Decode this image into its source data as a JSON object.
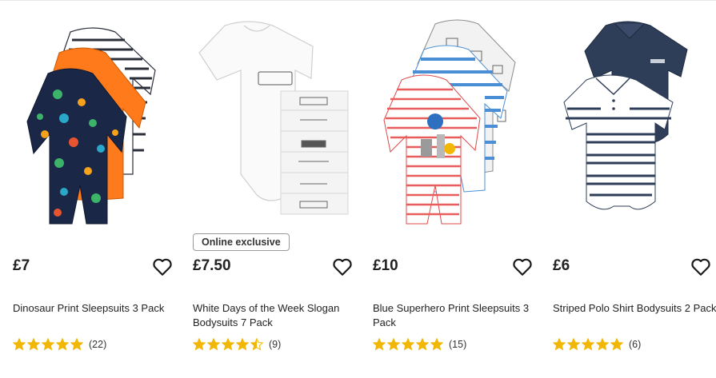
{
  "products": [
    {
      "title": "Dinosaur Print Sleepsuits 3 Pack",
      "price": "£7",
      "badge": "",
      "rating": 5,
      "review_count": "(22)",
      "image_icon": "dinosaur-sleepsuits-image"
    },
    {
      "title": "White Days of the Week Slogan Bodysuits 7 Pack",
      "price": "£7.50",
      "badge": "Online exclusive",
      "rating": 4.5,
      "review_count": "(9)",
      "image_icon": "white-bodysuits-image"
    },
    {
      "title": "Blue Superhero Print Sleepsuits 3 Pack",
      "price": "£10",
      "badge": "",
      "rating": 5,
      "review_count": "(15)",
      "image_icon": "superhero-sleepsuits-image"
    },
    {
      "title": "Striped Polo Shirt Bodysuits 2 Pack",
      "price": "£6",
      "badge": "",
      "rating": 5,
      "review_count": "(6)",
      "image_icon": "polo-bodysuits-image"
    }
  ],
  "colors": {
    "star": "#f2b705",
    "text": "#222222",
    "badge_border": "#9a9a9a"
  }
}
